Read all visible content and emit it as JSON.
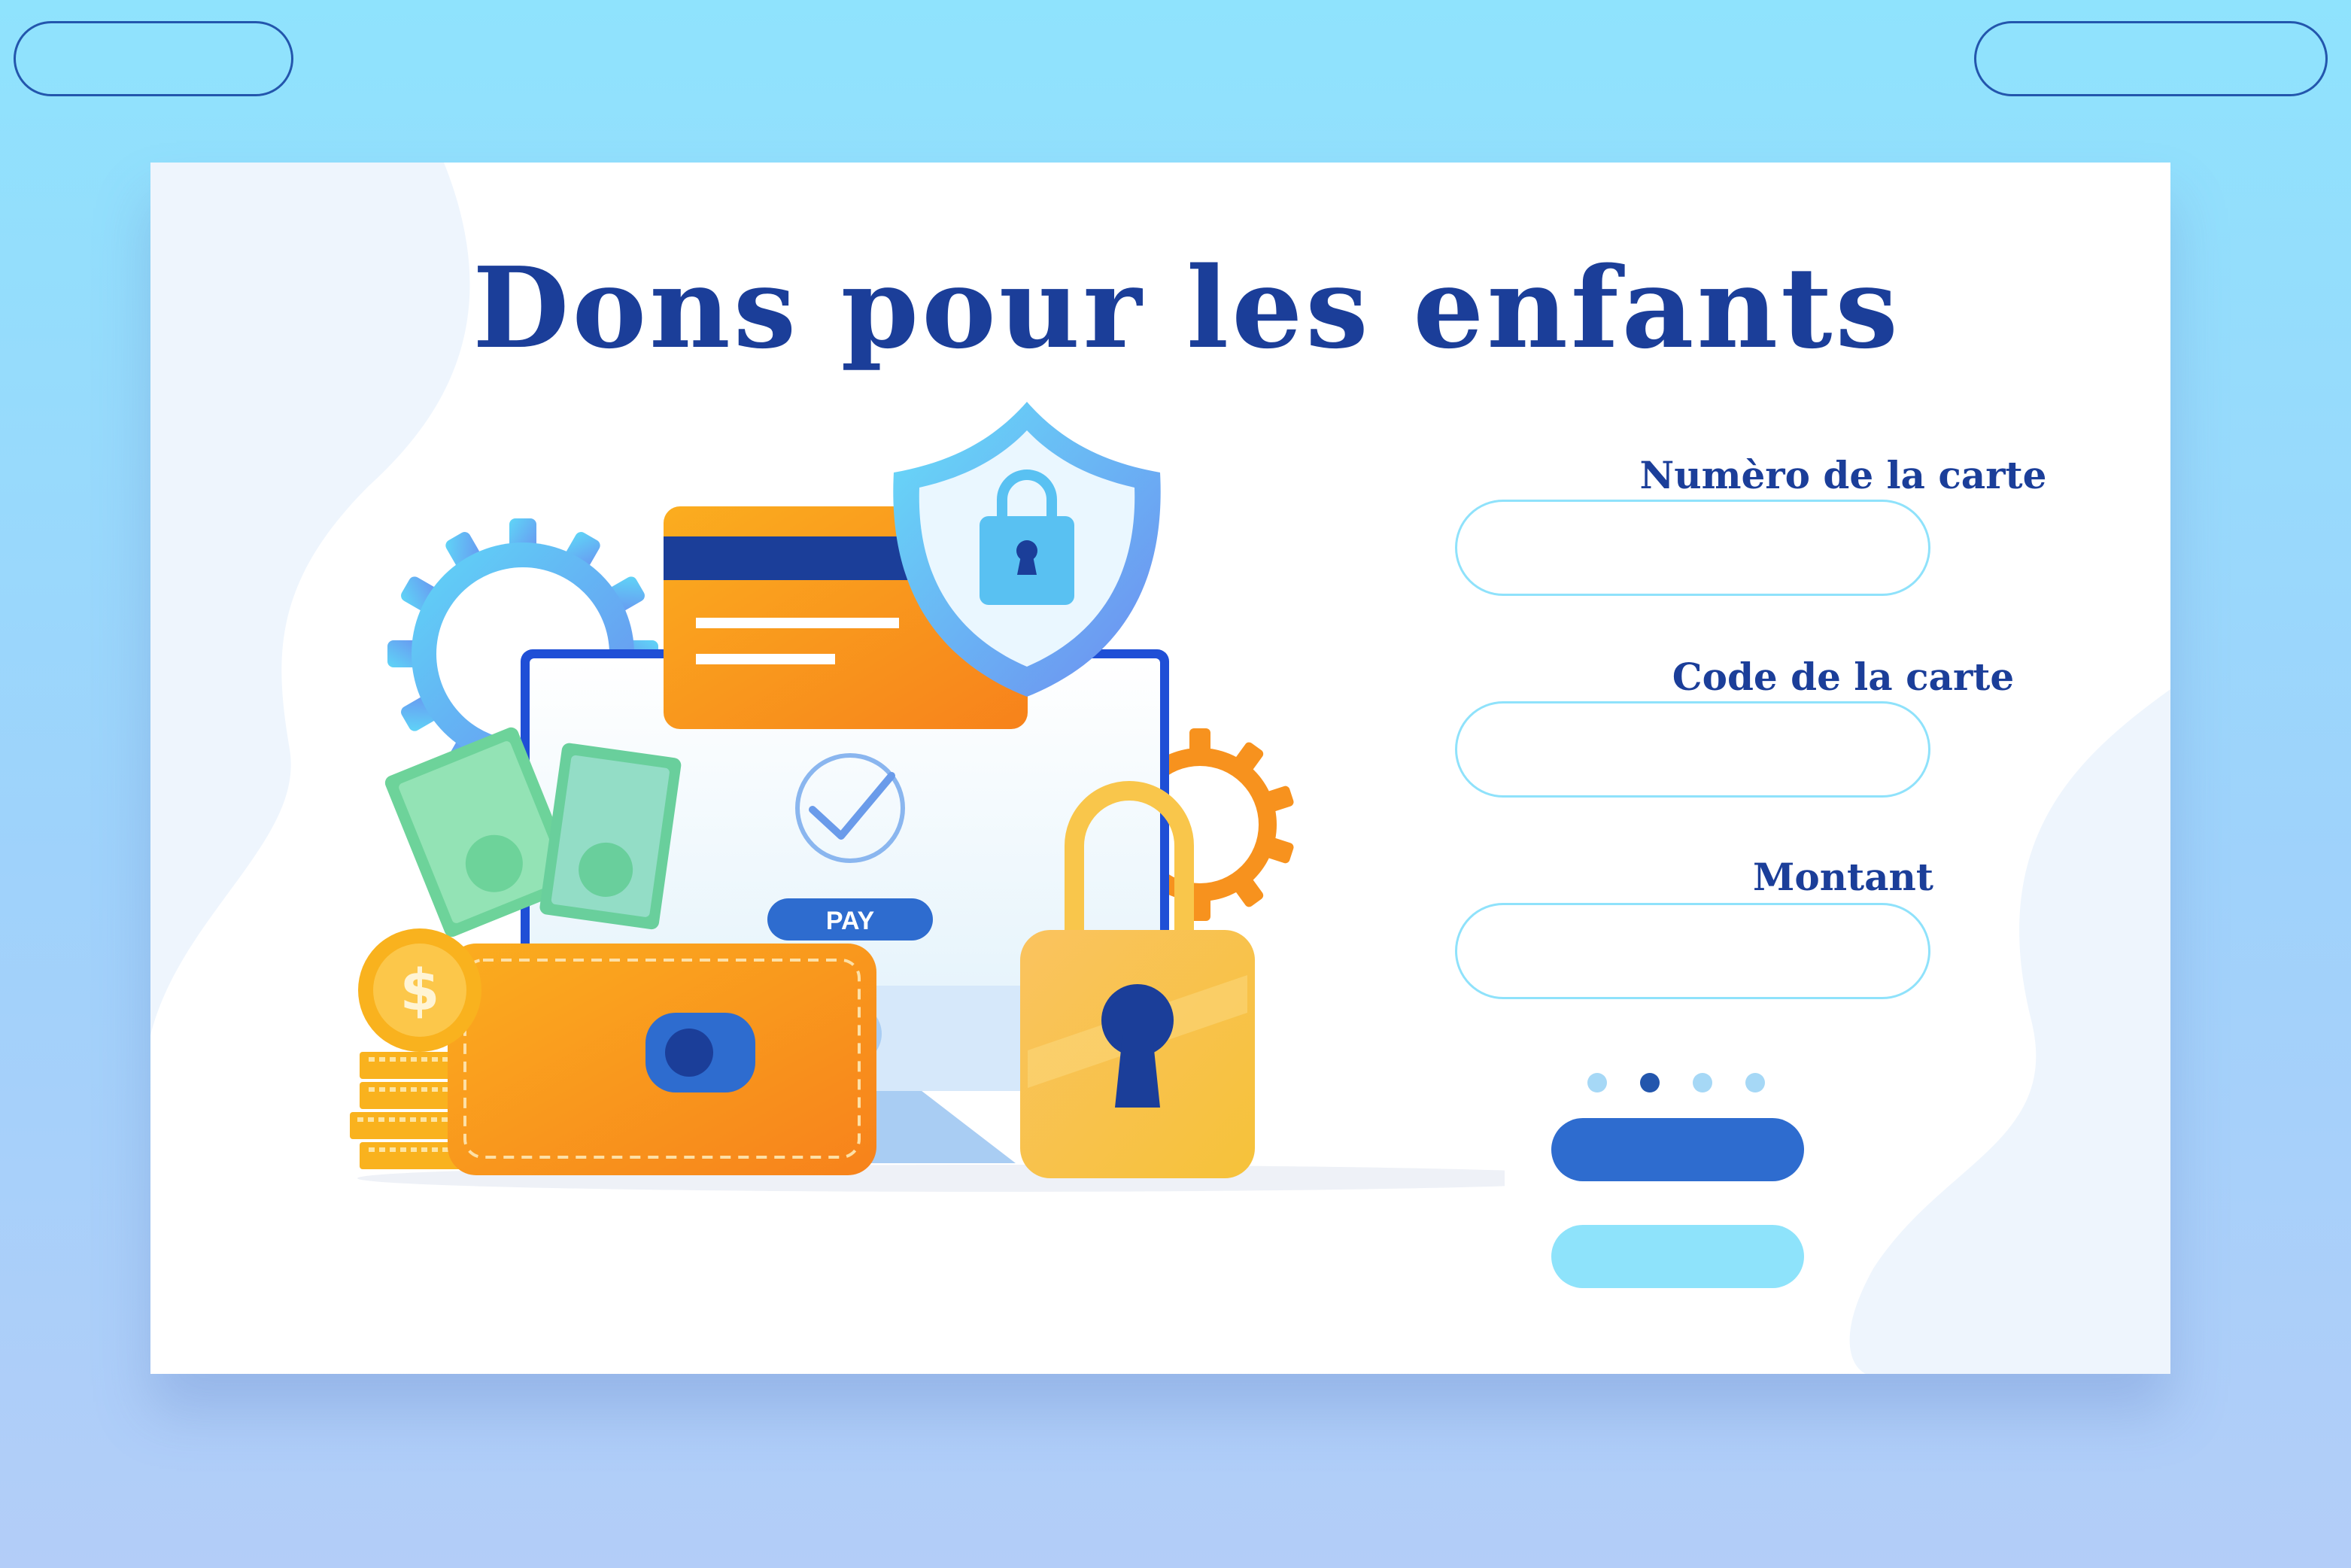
{
  "page": {
    "title": "Dons pour les enfants"
  },
  "illustration": {
    "pay_label": "PAY",
    "currency_symbol": "$"
  },
  "form": {
    "card_number_label": "Numèro de la carte",
    "card_number_value": "",
    "card_code_label": "Code de la carte",
    "card_code_value": "",
    "amount_label": "Montant",
    "amount_value": ""
  },
  "pagination": {
    "total": 4,
    "active_index": 1
  },
  "buttons": {
    "primary_label": "",
    "secondary_label": ""
  },
  "top_bar": {
    "left_pill_label": "",
    "right_pill_label": ""
  },
  "colors": {
    "page_background": "#8fe3fd",
    "title": "#1b3e99",
    "primary_button": "#2e6ccf",
    "secondary_button": "#8ee3fb",
    "input_border": "#8fe2fb"
  }
}
